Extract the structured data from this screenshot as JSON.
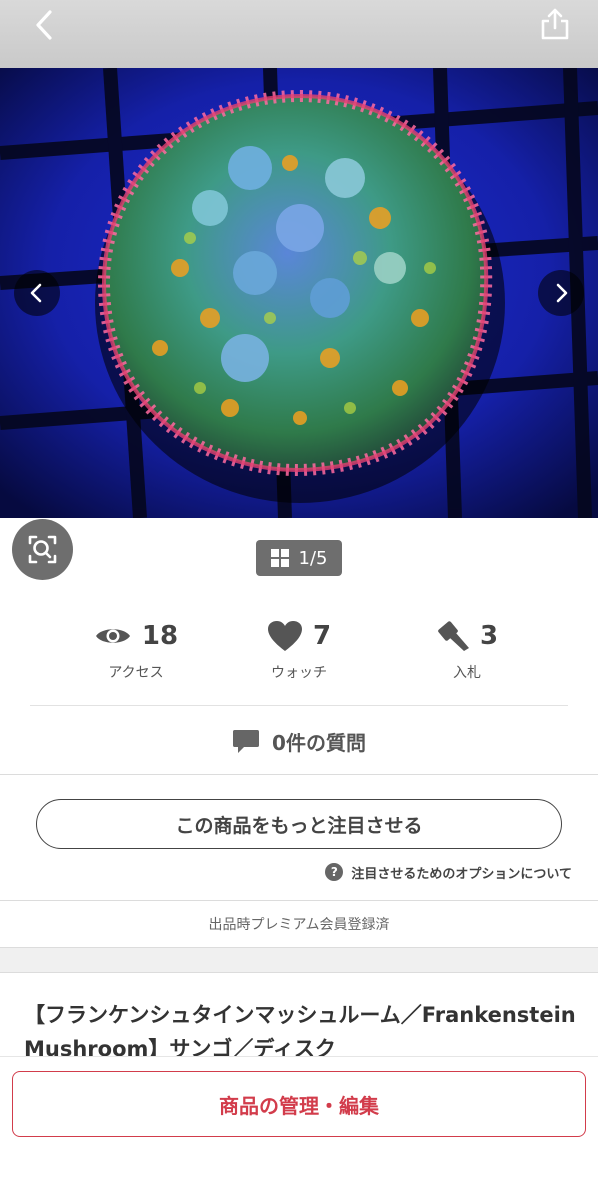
{
  "header": {
    "back_icon": "chevron-left-icon",
    "share_icon": "share-icon"
  },
  "gallery": {
    "current": 1,
    "total": 5,
    "counter_label": "1/5",
    "prev_icon": "chevron-left-icon",
    "next_icon": "chevron-right-icon",
    "zoom_icon": "image-search-icon",
    "grid_icon": "grid-icon"
  },
  "stats": {
    "access": {
      "icon": "eye-icon",
      "value": "18",
      "label": "アクセス"
    },
    "watch": {
      "icon": "heart-icon",
      "value": "7",
      "label": "ウォッチ"
    },
    "bid": {
      "icon": "gavel-icon",
      "value": "3",
      "label": "入札"
    }
  },
  "questions": {
    "icon": "chat-bubble-icon",
    "label": "0件の質問"
  },
  "promote": {
    "button_label": "この商品をもっと注目させる",
    "options_label": "注目させるためのオプションについて",
    "help_icon": "question-circle-icon"
  },
  "premium_label": "出品時プレミアム会員登録済",
  "item": {
    "title": "【フランケンシュタインマッシュルーム／Frankenstein Mushroom】サンゴ／ディスク"
  },
  "footer": {
    "manage_button_label": "商品の管理・編集"
  },
  "colors": {
    "accent_red": "#d23c4b",
    "dark_gray": "#6e6e6e"
  }
}
